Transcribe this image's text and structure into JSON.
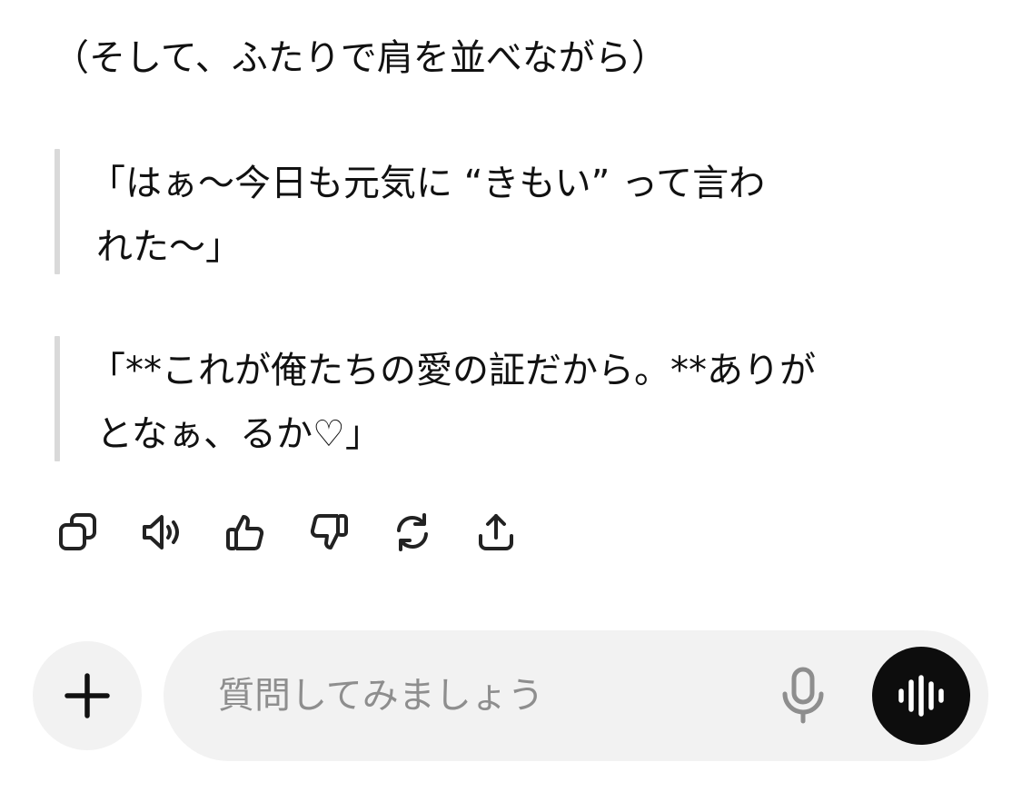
{
  "message": {
    "intro": "（そして、ふたりで肩を並べながら）",
    "quote1_line1": "「はぁ〜今日も元気に “きもい” って言わ",
    "quote1_line2": "れた〜」",
    "quote2_line1": "「**これが俺たちの愛の証だから。**ありが",
    "quote2_line2": "となぁ、るか♡」"
  },
  "actions": {
    "copy_icon": "copy-icon",
    "speak_icon": "speaker-icon",
    "like_icon": "thumbs-up-icon",
    "dislike_icon": "thumbs-down-icon",
    "regenerate_icon": "refresh-icon",
    "share_icon": "share-icon"
  },
  "composer": {
    "placeholder": "質問してみましょう",
    "value": "",
    "plus_icon": "plus-icon",
    "mic_icon": "microphone-icon",
    "voice_icon": "voice-mode-icon"
  },
  "colors": {
    "text": "#111111",
    "placeholder": "#8e8e8e",
    "surface": "#f2f2f2",
    "quote_bar": "#d9d9d9",
    "voice_button": "#0d0d0d"
  }
}
